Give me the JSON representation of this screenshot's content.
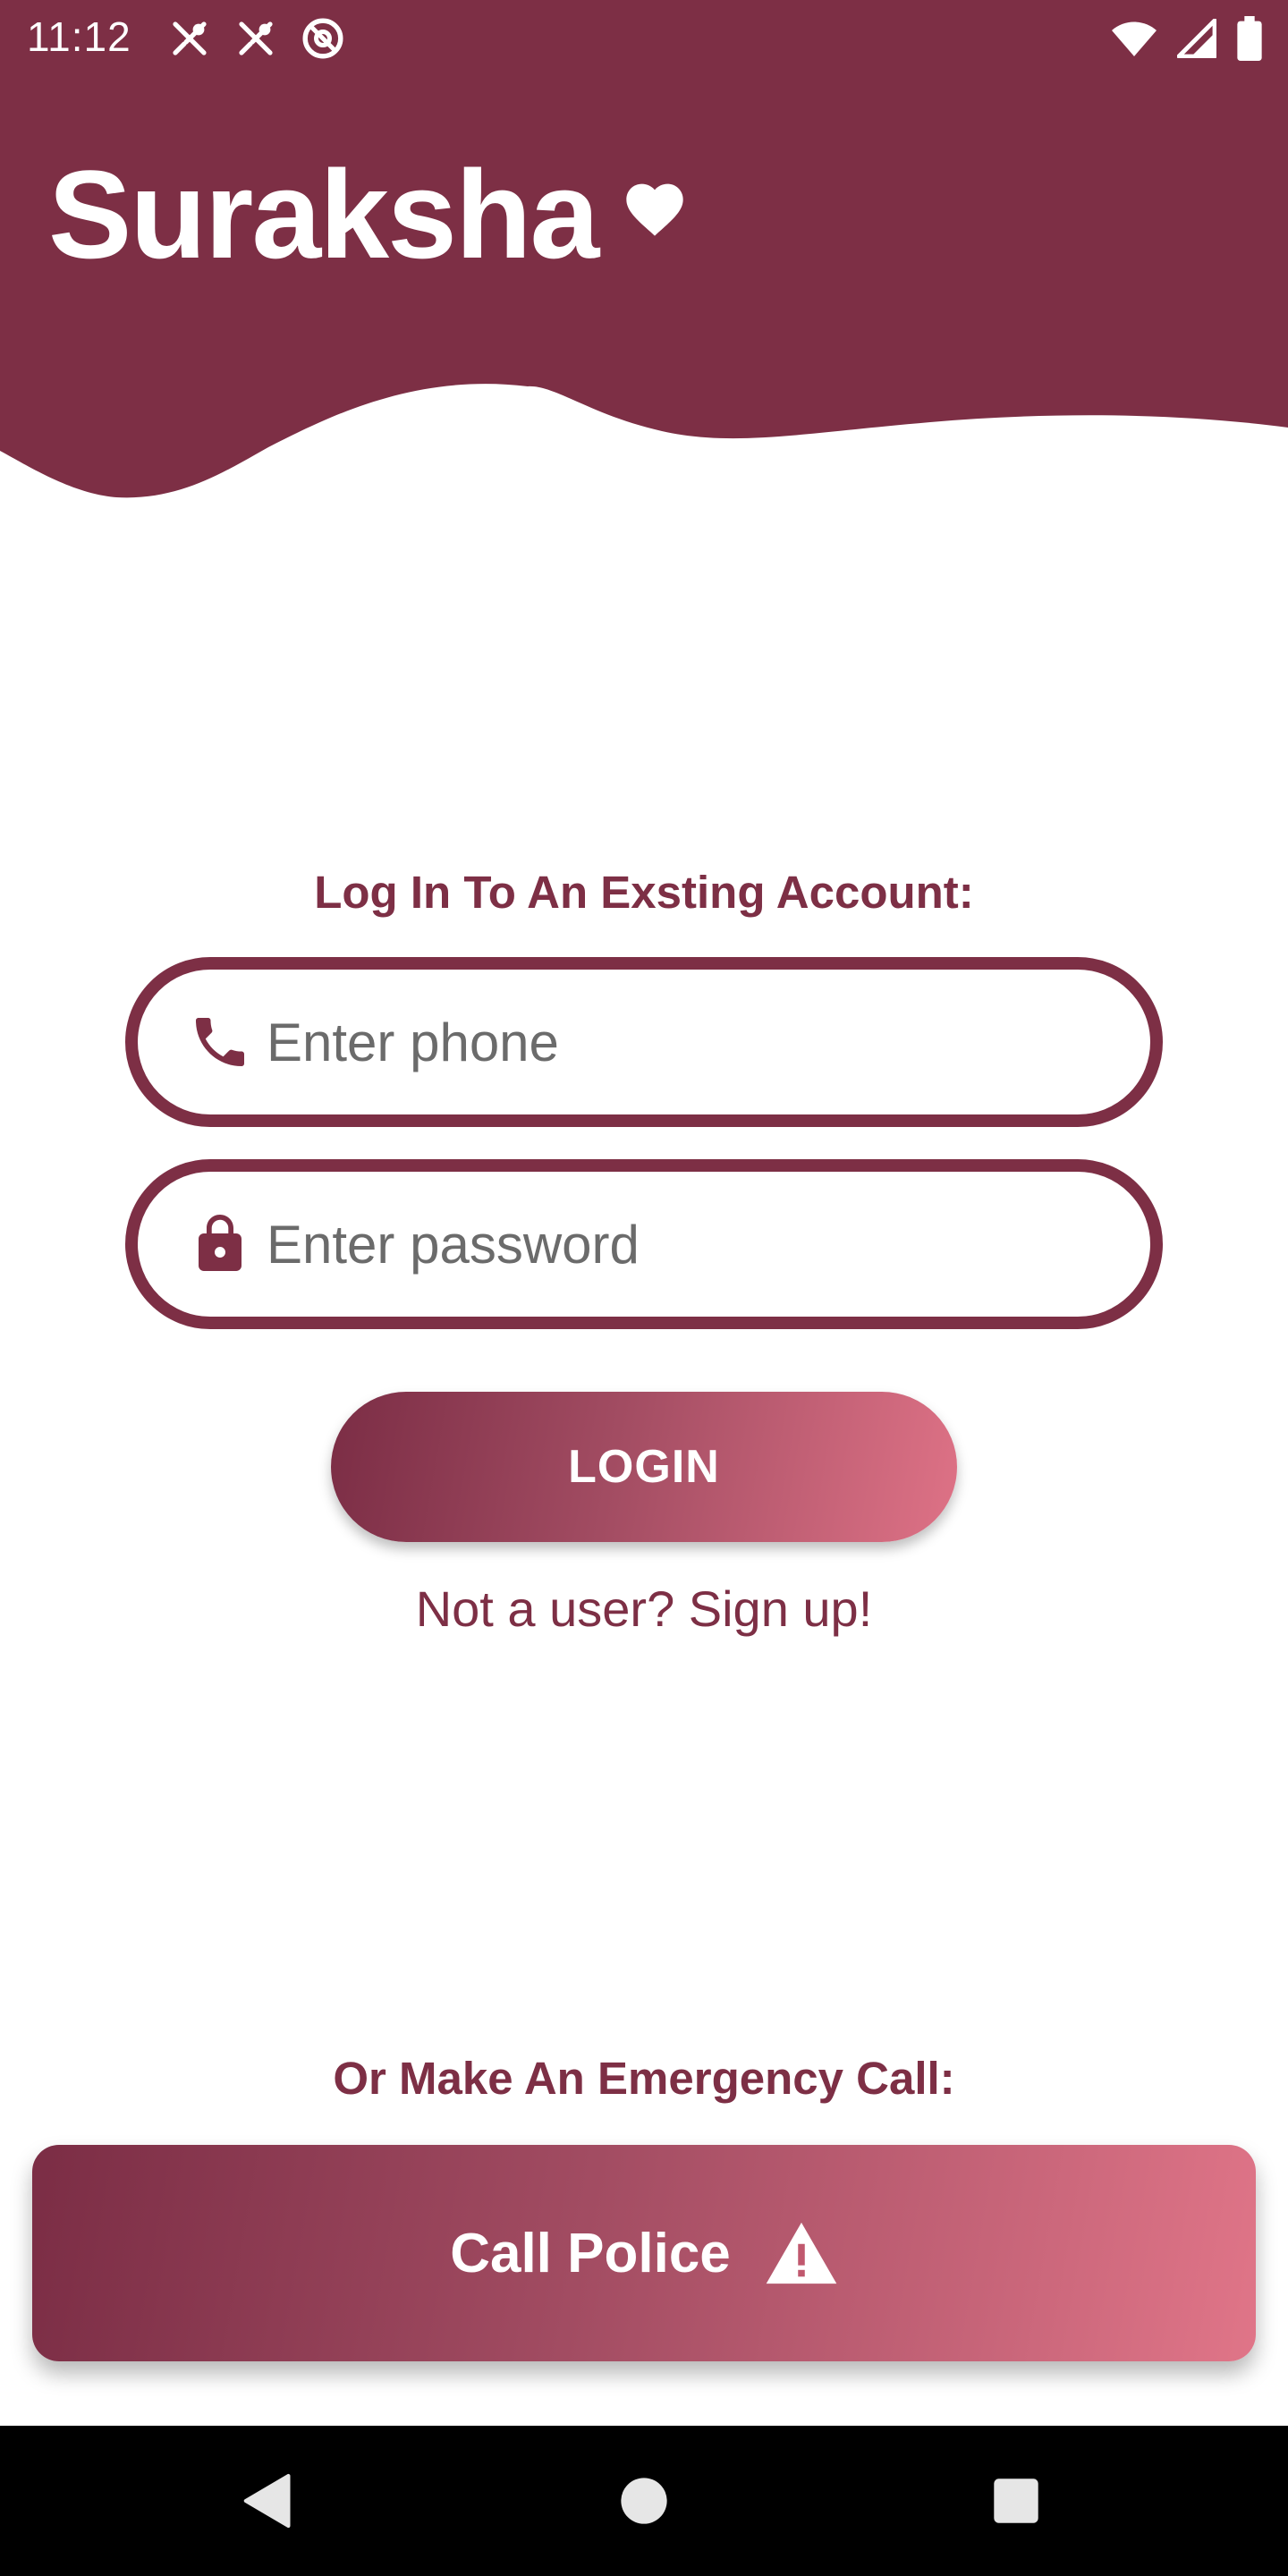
{
  "colors": {
    "brand": "#7d2f45",
    "gradient_start": "#7b2d45",
    "gradient_end": "#de7286",
    "background": "#ffffff",
    "nav_bar": "#000000"
  },
  "status_bar": {
    "time": "11:12",
    "left_icons": [
      "restaurant-icon",
      "restaurant-icon",
      "do-not-disturb-icon"
    ],
    "right_icons": [
      "wifi-icon",
      "cellular-signal-icon",
      "battery-icon"
    ]
  },
  "header": {
    "app_title": "Suraksha",
    "title_icon": "heart-icon"
  },
  "login": {
    "heading": "Log In To An Exsting Account:",
    "phone_field": {
      "icon": "phone-icon",
      "value": "",
      "placeholder": "Enter phone"
    },
    "password_field": {
      "icon": "lock-icon",
      "value": "",
      "placeholder": "Enter password"
    },
    "login_button_label": "LOGIN",
    "signup_link": "Not a user? Sign up!"
  },
  "emergency": {
    "heading": "Or Make An Emergency Call:",
    "call_button_label": "Call Police",
    "call_button_icon": "warning-icon"
  },
  "nav_bar": {
    "buttons": [
      "back-icon",
      "home-icon",
      "recents-icon"
    ]
  }
}
